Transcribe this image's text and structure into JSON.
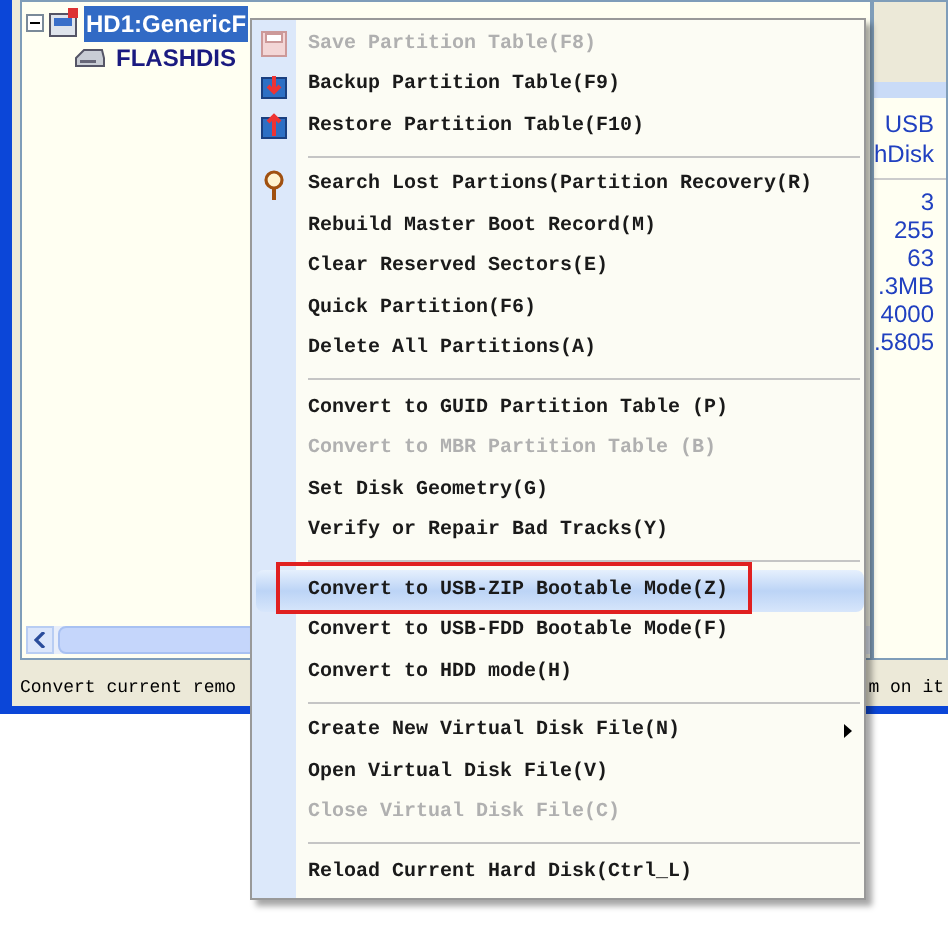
{
  "tree": {
    "items": [
      {
        "label": "HD1:GenericF",
        "selected": true,
        "expanded": true,
        "children": [
          {
            "label": "FLASHDIS",
            "selected": false
          }
        ]
      }
    ]
  },
  "right_panel": {
    "header": [
      "USB",
      "hDisk"
    ],
    "values": [
      "3",
      "255",
      "63",
      ".3MB",
      "4000",
      ".5805"
    ]
  },
  "status_bar": {
    "left": "Convert current remo",
    "right": "m on it"
  },
  "context_menu": {
    "items": [
      {
        "kind": "item",
        "label": "Save Partition Table(F8)",
        "disabled": true,
        "selected": false
      },
      {
        "kind": "item",
        "label": "Backup Partition Table(F9)",
        "disabled": false,
        "selected": false
      },
      {
        "kind": "item",
        "label": "Restore Partition Table(F10)",
        "disabled": false,
        "selected": false
      },
      {
        "kind": "separator"
      },
      {
        "kind": "item",
        "label": "Search Lost Partions(Partition Recovery(R)",
        "disabled": false,
        "selected": false
      },
      {
        "kind": "item",
        "label": "Rebuild Master Boot Record(M)",
        "disabled": false,
        "selected": false
      },
      {
        "kind": "item",
        "label": "Clear Reserved Sectors(E)",
        "disabled": false,
        "selected": false
      },
      {
        "kind": "item",
        "label": "Quick Partition(F6)",
        "disabled": false,
        "selected": false
      },
      {
        "kind": "item",
        "label": "Delete All Partitions(A)",
        "disabled": false,
        "selected": false
      },
      {
        "kind": "separator"
      },
      {
        "kind": "item",
        "label": "Convert to GUID Partition Table (P)",
        "disabled": false,
        "selected": false
      },
      {
        "kind": "item",
        "label": "Convert to MBR Partition Table (B)",
        "disabled": true,
        "selected": false
      },
      {
        "kind": "item",
        "label": "Set Disk Geometry(G)",
        "disabled": false,
        "selected": false
      },
      {
        "kind": "item",
        "label": "Verify or Repair Bad Tracks(Y)",
        "disabled": false,
        "selected": false
      },
      {
        "kind": "separator"
      },
      {
        "kind": "item",
        "label": "Convert to USB-ZIP Bootable Mode(Z)",
        "disabled": false,
        "selected": true,
        "annotated": true
      },
      {
        "kind": "item",
        "label": "Convert to USB-FDD Bootable Mode(F)",
        "disabled": false,
        "selected": false
      },
      {
        "kind": "item",
        "label": "Convert to HDD mode(H)",
        "disabled": false,
        "selected": false
      },
      {
        "kind": "separator"
      },
      {
        "kind": "item",
        "label": "Create New Virtual Disk File(N)",
        "disabled": false,
        "selected": false,
        "submenu": true
      },
      {
        "kind": "item",
        "label": "Open Virtual Disk File(V)",
        "disabled": false,
        "selected": false
      },
      {
        "kind": "item",
        "label": "Close Virtual Disk File(C)",
        "disabled": true,
        "selected": false
      },
      {
        "kind": "separator"
      },
      {
        "kind": "item",
        "label": "Reload Current Hard Disk(Ctrl_L)",
        "disabled": false,
        "selected": false
      }
    ]
  }
}
